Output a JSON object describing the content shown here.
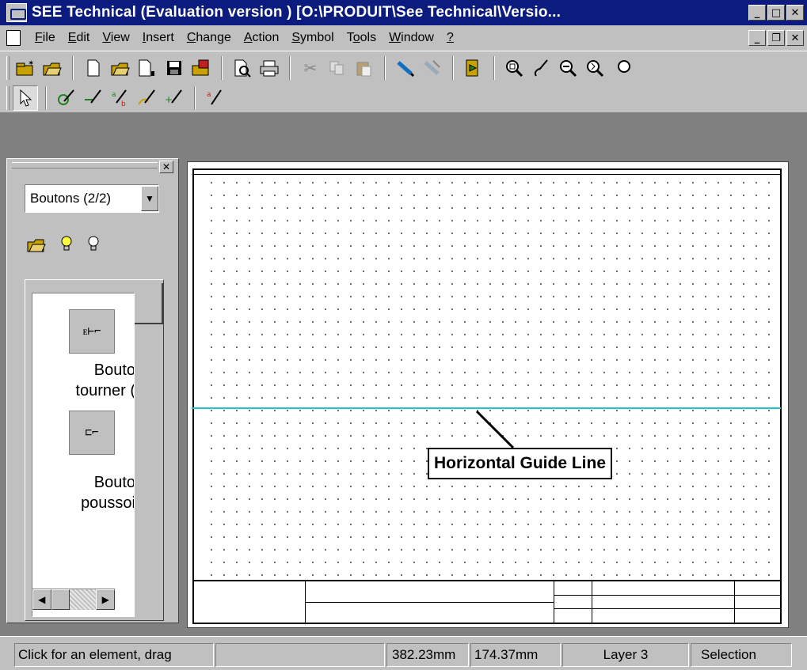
{
  "window": {
    "title": "SEE Technical (Evaluation version ) [O:\\PRODUIT\\See Technical\\Versio...",
    "minimize_glyph": "_",
    "maximize_glyph": "□",
    "close_glyph": "✕",
    "restore_glyph": "❐"
  },
  "menu": {
    "items": [
      {
        "label": "File",
        "ul": "F",
        "rest": "ile"
      },
      {
        "label": "Edit",
        "ul": "E",
        "rest": "dit"
      },
      {
        "label": "View",
        "ul": "V",
        "rest": "iew"
      },
      {
        "label": "Insert",
        "ul": "I",
        "rest": "nsert"
      },
      {
        "label": "Change",
        "ul": "C",
        "rest": "hange"
      },
      {
        "label": "Action",
        "ul": "A",
        "rest": "ction"
      },
      {
        "label": "Symbol",
        "ul": "S",
        "rest": "ymbol"
      },
      {
        "label": "Tools",
        "pre": "T",
        "ul": "o",
        "rest": "ols"
      },
      {
        "label": "Window",
        "ul": "W",
        "rest": "indow"
      },
      {
        "label": "?",
        "ul": "?",
        "rest": ""
      }
    ]
  },
  "toolbar_icons": {
    "row1": [
      "new-project-icon",
      "open-project-icon",
      "new-document-icon",
      "open-document-icon",
      "new-page-icon",
      "save-icon",
      "save-as-icon",
      "print-preview-icon",
      "print-icon",
      "cut-icon",
      "copy-icon",
      "paste-icon",
      "draw-wire-icon",
      "erase-wire-icon",
      "exit-icon",
      "zoom-window-icon",
      "zoom-pen-icon",
      "zoom-out-icon",
      "zoom-pan-icon",
      "zoom-all-icon"
    ],
    "row2": [
      "selection-arrow-icon",
      "symbol-pen-icon",
      "line-pen-icon",
      "text-pen-icon",
      "curve-pen-icon",
      "move-pen-icon",
      "attribute-pen-icon"
    ]
  },
  "panel": {
    "close_glyph": "✕",
    "combo_value": "Boutons (2/2)",
    "combo_arrow": "▼",
    "symbols": [
      {
        "label": "Bouto\ntourner (",
        "thumb": "ᴇ⊢⌐"
      },
      {
        "label": "Bouto\npoussoi",
        "thumb": "⊏⌐"
      }
    ],
    "scroll_left": "◀",
    "scroll_right": "▶"
  },
  "drawing": {
    "callout_text": "Horizontal Guide Line",
    "guide_color": "#22c5c5"
  },
  "status": {
    "hint": "Click for an element, drag",
    "x": "382.23mm",
    "y": "174.37mm",
    "layer": "Layer 3",
    "mode": "Selection"
  },
  "colors": {
    "titlebar": "#0b1b7e",
    "chrome": "#c0c0c0"
  }
}
